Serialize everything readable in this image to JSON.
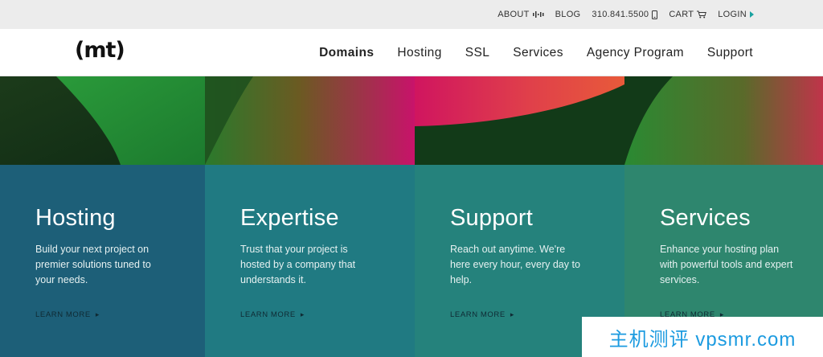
{
  "utility": {
    "about": "ABOUT",
    "blog": "BLOG",
    "phone": "310.841.5500",
    "cart": "CART",
    "login": "LOGIN"
  },
  "logo": "(mt)",
  "nav": [
    "Domains",
    "Hosting",
    "SSL",
    "Services",
    "Agency Program",
    "Support"
  ],
  "columns": [
    {
      "title": "Hosting",
      "desc": "Build your next project on premier solutions tuned to your needs.",
      "cta": "LEARN MORE",
      "colors": {
        "panel": "#1d5f78"
      }
    },
    {
      "title": "Expertise",
      "desc": "Trust that your project is hosted by a company that understands it.",
      "cta": "LEARN MORE",
      "colors": {
        "panel": "#207a82"
      }
    },
    {
      "title": "Support",
      "desc": "Reach out anytime. We're here every hour, every day to help.",
      "cta": "LEARN MORE",
      "colors": {
        "panel": "#25827c"
      }
    },
    {
      "title": "Services",
      "desc": "Enhance your hosting plan with powerful tools and expert services.",
      "cta": "LEARN MORE",
      "colors": {
        "panel": "#2e866e"
      }
    }
  ],
  "watermark": "主机测评 vpsmr.com",
  "icons": {
    "about": "equalizer-icon",
    "phone": "phone-icon",
    "cart": "cart-icon",
    "login": "triangle-right-icon",
    "cta": "chevron-right-icon"
  },
  "colors": {
    "accent_teal": "#1aa2a0",
    "nav_text": "#222222",
    "utility_bg": "#ececec"
  }
}
